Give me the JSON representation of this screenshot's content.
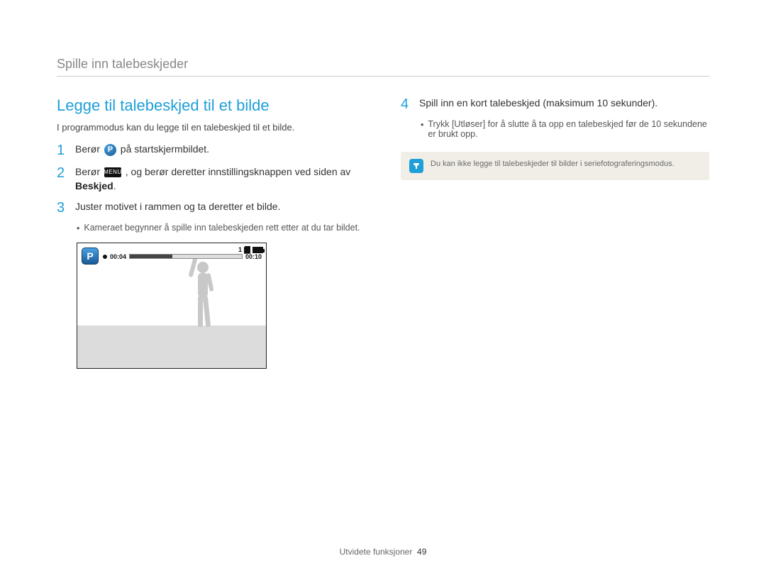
{
  "header": {
    "title": "Spille inn talebeskjeder"
  },
  "left": {
    "heading": "Legge til talebeskjed til et bilde",
    "intro": "I programmodus kan du legge til en talebeskjed til et bilde.",
    "step1": {
      "num": "1",
      "before": "Berør ",
      "after": " på startskjermbildet."
    },
    "step2": {
      "num": "2",
      "before": "Berør ",
      "mid": " , og berør deretter innstillingsknappen ved siden av ",
      "bold": "Beskjed",
      "after": "."
    },
    "step3": {
      "num": "3",
      "text": "Juster motivet i rammen og ta deretter et bilde.",
      "sub": "Kameraet begynner å spille inn talebeskjeden rett etter at du tar bildet."
    },
    "preview": {
      "p_letter": "P",
      "rec_time": "00:04",
      "total_time": "00:10",
      "count": "1"
    }
  },
  "right": {
    "step4": {
      "num": "4",
      "text": "Spill inn en kort talebeskjed (maksimum 10 sekunder).",
      "sub_before": "Trykk [",
      "sub_bold": "Utløser",
      "sub_after": "] for å slutte å ta opp en talebeskjed før de 10 sekundene er brukt opp."
    },
    "note": "Du kan ikke legge til talebeskjeder til bilder i seriefotograferingsmodus."
  },
  "icons": {
    "menu_label": "MENU"
  },
  "footer": {
    "section": "Utvidete funksjoner",
    "page": "49"
  }
}
